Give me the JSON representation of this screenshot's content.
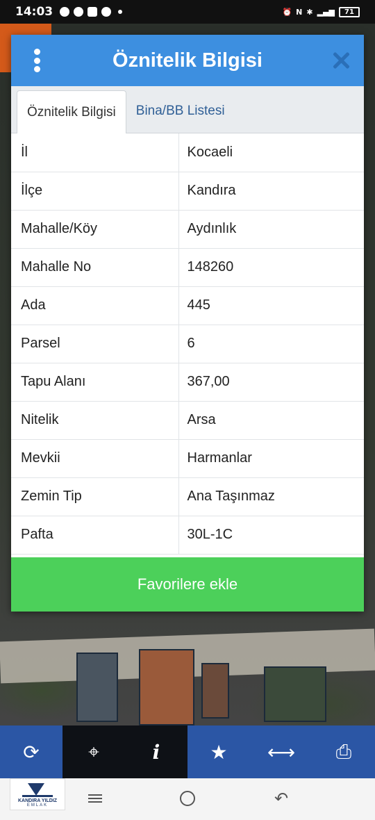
{
  "status_bar": {
    "time": "14:03",
    "battery": "71"
  },
  "dialog": {
    "title": "Öznitelik Bilgisi",
    "tabs": [
      {
        "label": "Öznitelik Bilgisi",
        "active": true
      },
      {
        "label": "Bina/BB Listesi",
        "active": false
      }
    ],
    "rows": [
      {
        "key": "İl",
        "value": "Kocaeli"
      },
      {
        "key": "İlçe",
        "value": "Kandıra"
      },
      {
        "key": "Mahalle/Köy",
        "value": "Aydınlık"
      },
      {
        "key": "Mahalle No",
        "value": "148260"
      },
      {
        "key": "Ada",
        "value": "445"
      },
      {
        "key": "Parsel",
        "value": "6"
      },
      {
        "key": "Tapu Alanı",
        "value": "367,00"
      },
      {
        "key": "Nitelik",
        "value": "Arsa"
      },
      {
        "key": "Mevkii",
        "value": "Harmanlar"
      },
      {
        "key": "Zemin Tip",
        "value": "Ana Taşınmaz"
      },
      {
        "key": "Pafta",
        "value": "30L-1C"
      }
    ],
    "favorite_button": "Favorilere ekle"
  },
  "toolbar": {
    "items": [
      "refresh-icon",
      "locate-icon",
      "info-icon",
      "star-icon",
      "measure-icon",
      "print-icon"
    ]
  },
  "logo": {
    "line1": "KANDIRA YILDIZ",
    "line2": "EMLAK"
  },
  "colors": {
    "header": "#3d8fe0",
    "favorite": "#4cd05a",
    "toolbar": "#2b56a5"
  }
}
